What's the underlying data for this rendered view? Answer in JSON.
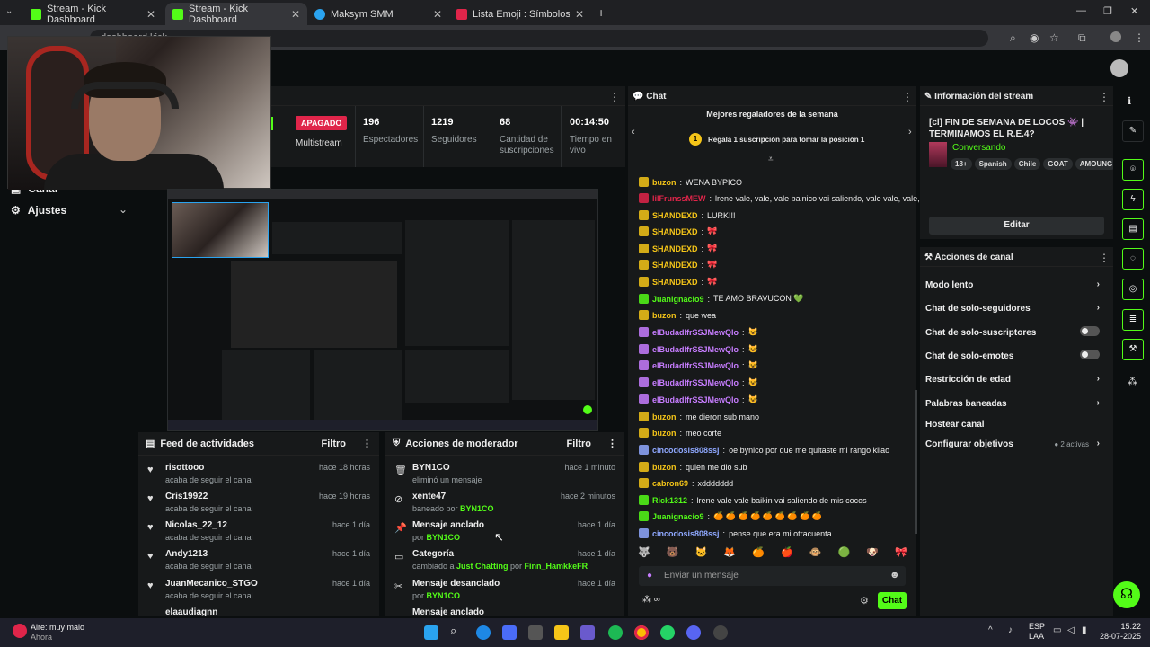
{
  "browser": {
    "tabs": [
      {
        "label": "Stream - Kick Dashboard",
        "color": "#53fc18"
      },
      {
        "label": "Stream - Kick Dashboard",
        "color": "#53fc18"
      },
      {
        "label": "Maksym SMM",
        "color": "#2aa3ef"
      },
      {
        "label": "Lista Emoji : Símbolos emoji na",
        "color": "#e0254a"
      }
    ],
    "url": "dashboard.kick..."
  },
  "nav": {
    "canal": "Canal",
    "ajustes": "Ajustes"
  },
  "stats": {
    "status": "APAGADO",
    "multistream": "Multistream",
    "viewers": "196",
    "viewers_lbl": "Espectadores",
    "followers": "1219",
    "followers_lbl": "Seguidores",
    "subs": "68",
    "subs_lbl": "Cantidad de suscripciones",
    "time": "00:14:50",
    "time_lbl": "Tiempo en vivo"
  },
  "activity": {
    "title": "Feed de actividades",
    "filter": "Filtro",
    "items": [
      {
        "name": "risottooo",
        "sub": "acaba de seguir el canal",
        "time": "hace 18 horas"
      },
      {
        "name": "Cris19922",
        "sub": "acaba de seguir el canal",
        "time": "hace 19 horas"
      },
      {
        "name": "Nicolas_22_12",
        "sub": "acaba de seguir el canal",
        "time": "hace 1 día"
      },
      {
        "name": "Andy1213",
        "sub": "acaba de seguir el canal",
        "time": "hace 1 día"
      },
      {
        "name": "JuanMecanico_STGO",
        "sub": "acaba de seguir el canal",
        "time": "hace 1 día"
      },
      {
        "name": "elaaudiagnn",
        "sub": "",
        "time": ""
      }
    ]
  },
  "mod": {
    "title": "Acciones de moderador",
    "filter": "Filtro",
    "items": [
      {
        "name": "BYN1CO",
        "sub": "eliminó un mensaje",
        "time": "hace 1 minuto",
        "icon": "trash-icon"
      },
      {
        "name": "xente47",
        "sub_a": "baneado por ",
        "sub_b": "BYN1CO",
        "time": "hace 2 minutos",
        "icon": "ban-icon"
      },
      {
        "name": "Mensaje anclado",
        "sub_a": "por ",
        "sub_b": "BYN1CO",
        "time": "hace 1 día",
        "icon": "pin-icon"
      },
      {
        "name": "Categoría",
        "sub_a": "cambiado a ",
        "sub_b": "Just Chatting",
        "sub_c": " por ",
        "sub_d": "Finn_HamkkeFR",
        "time": "hace 1 día",
        "icon": "category-icon"
      },
      {
        "name": "Mensaje desanclado",
        "sub_a": "por ",
        "sub_b": "BYN1CO",
        "time": "hace 1 día",
        "icon": "unpin-icon"
      },
      {
        "name": "Mensaje anclado",
        "sub_a": "",
        "sub_b": "",
        "time": "",
        "icon": "pin-icon"
      }
    ]
  },
  "chat": {
    "title": "Chat",
    "top_gifters": "Mejores regaladores de la semana",
    "gift_prompt": "Regala 1 suscripción para tomar la posición 1",
    "input_placeholder": "Enviar un mensaje",
    "send": "Chat",
    "messages": [
      {
        "user": "buzon",
        "color": "#f5c518",
        "text": "WENA BYPICO"
      },
      {
        "user": "lilFrunssMEW",
        "color": "#e0254a",
        "text": "lrene vale, vale, vale bainico vai saliendo, vale vale, vale,"
      },
      {
        "user": "SHANDEXD",
        "color": "#f5c518",
        "text": "LURK!!!"
      },
      {
        "user": "SHANDEXD",
        "color": "#f5c518",
        "text": "🎀"
      },
      {
        "user": "SHANDEXD",
        "color": "#f5c518",
        "text": "🎀"
      },
      {
        "user": "SHANDEXD",
        "color": "#f5c518",
        "text": "🎀"
      },
      {
        "user": "SHANDEXD",
        "color": "#f5c518",
        "text": "🎀"
      },
      {
        "user": "Juanignacio9",
        "color": "#53fc18",
        "text": "TE AMO BRAVUCON 💚"
      },
      {
        "user": "buzon",
        "color": "#f5c518",
        "text": "que wea"
      },
      {
        "user": "elBudadlfrSSJMewQlo",
        "color": "#c77dff",
        "text": "😺"
      },
      {
        "user": "elBudadlfrSSJMewQlo",
        "color": "#c77dff",
        "text": "😺"
      },
      {
        "user": "elBudadlfrSSJMewQlo",
        "color": "#c77dff",
        "text": "😺"
      },
      {
        "user": "elBudadlfrSSJMewQlo",
        "color": "#c77dff",
        "text": "😺"
      },
      {
        "user": "elBudadlfrSSJMewQlo",
        "color": "#c77dff",
        "text": "😺"
      },
      {
        "user": "buzon",
        "color": "#f5c518",
        "text": "me dieron sub mano"
      },
      {
        "user": "buzon",
        "color": "#f5c518",
        "text": "meo corte"
      },
      {
        "user": "cincodosis808ssj",
        "color": "#8fa8ff",
        "text": "oe bynico por que me quitaste mi rango kliao"
      },
      {
        "user": "buzon",
        "color": "#f5c518",
        "text": "quien me dio sub"
      },
      {
        "user": "cabron69",
        "color": "#f5c518",
        "text": "xddddddd"
      },
      {
        "user": "Rick1312",
        "color": "#53fc18",
        "text": "lrene vale vale baikin vai saliendo de mis cocos"
      },
      {
        "user": "Juanignacio9",
        "color": "#53fc18",
        "text": "🍊 🍊 🍊 🍊 🍊 🍊 🍊 🍊 🍊"
      },
      {
        "user": "cincodosis808ssj",
        "color": "#8fa8ff",
        "text": "pense que era mi otracuenta"
      }
    ]
  },
  "info": {
    "title": "Información del stream",
    "stream_title": "[cl] FIN DE SEMANA DE LOCOS 👾 | TERMINAMOS EL R.E.4?",
    "category": "Conversando",
    "tags": [
      "18+",
      "Spanish",
      "Chile",
      "GOAT",
      "AMOUNG"
    ],
    "edit": "Editar"
  },
  "channel_actions": {
    "title": "Acciones de canal",
    "items": [
      {
        "label": "Modo lento",
        "kind": "chevron"
      },
      {
        "label": "Chat de solo-seguidores",
        "kind": "chevron"
      },
      {
        "label": "Chat de solo-suscriptores",
        "kind": "toggle"
      },
      {
        "label": "Chat de solo-emotes",
        "kind": "toggle"
      },
      {
        "label": "Restricción de edad",
        "kind": "chevron"
      },
      {
        "label": "Palabras baneadas",
        "kind": "chevron"
      },
      {
        "label": "Hostear canal",
        "kind": "none"
      },
      {
        "label": "Configurar objetivos",
        "kind": "chevron",
        "extra": "● 2 activas"
      }
    ]
  },
  "taskbar": {
    "weather_title": "Aire: muy malo",
    "weather_sub": "Ahora",
    "lang": "ESP",
    "lang2": "LAA",
    "time": "15:22",
    "date": "28-07-2025"
  }
}
